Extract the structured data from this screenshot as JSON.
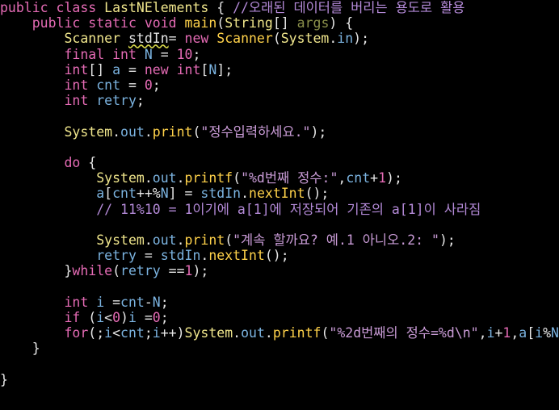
{
  "theme": {
    "background": "#000000",
    "keyword": "#e56bb5",
    "class_name": "#f0e68c",
    "identifier": "#7bb3e0",
    "function": "#ffd24a",
    "number": "#e56bb5",
    "string": "#c99bd6",
    "comment": "#b48ad8",
    "punctuation": "#e6e6e6"
  },
  "code": [
    [
      [
        "kw",
        "public"
      ],
      [
        "pl",
        " "
      ],
      [
        "kw",
        "class"
      ],
      [
        "pl",
        " "
      ],
      [
        "cls",
        "LastNElements"
      ],
      [
        "pl",
        " "
      ],
      [
        "pu",
        "{"
      ],
      [
        "pl",
        " "
      ],
      [
        "cm",
        "//오래된 데이터를 버리는 용도로 활용"
      ]
    ],
    [
      [
        "pl",
        "    "
      ],
      [
        "kw",
        "public"
      ],
      [
        "pl",
        " "
      ],
      [
        "kw",
        "static"
      ],
      [
        "pl",
        " "
      ],
      [
        "kw",
        "void"
      ],
      [
        "pl",
        " "
      ],
      [
        "fn",
        "main"
      ],
      [
        "pu",
        "("
      ],
      [
        "cls",
        "String"
      ],
      [
        "pu",
        "[]"
      ],
      [
        "pl",
        " "
      ],
      [
        "arg",
        "args"
      ],
      [
        "pu",
        ")"
      ],
      [
        "pl",
        " "
      ],
      [
        "pu",
        "{"
      ]
    ],
    [
      [
        "pl",
        "        "
      ],
      [
        "cls",
        "Scanner"
      ],
      [
        "pl",
        " "
      ],
      [
        "warn",
        "stdIn"
      ],
      [
        "pu",
        "="
      ],
      [
        "pl",
        " "
      ],
      [
        "kw",
        "new"
      ],
      [
        "pl",
        " "
      ],
      [
        "fn",
        "Scanner"
      ],
      [
        "pu",
        "("
      ],
      [
        "cls",
        "System"
      ],
      [
        "pu",
        "."
      ],
      [
        "id",
        "in"
      ],
      [
        "pu",
        ");"
      ]
    ],
    [
      [
        "pl",
        "        "
      ],
      [
        "kw",
        "final"
      ],
      [
        "pl",
        " "
      ],
      [
        "kw",
        "int"
      ],
      [
        "pl",
        " "
      ],
      [
        "id",
        "N"
      ],
      [
        "pl",
        " "
      ],
      [
        "pu",
        "="
      ],
      [
        "pl",
        " "
      ],
      [
        "num",
        "10"
      ],
      [
        "pu",
        ";"
      ]
    ],
    [
      [
        "pl",
        "        "
      ],
      [
        "kw",
        "int"
      ],
      [
        "pu",
        "[]"
      ],
      [
        "pl",
        " "
      ],
      [
        "id",
        "a"
      ],
      [
        "pl",
        " "
      ],
      [
        "pu",
        "="
      ],
      [
        "pl",
        " "
      ],
      [
        "kw",
        "new"
      ],
      [
        "pl",
        " "
      ],
      [
        "kw",
        "int"
      ],
      [
        "pu",
        "["
      ],
      [
        "id",
        "N"
      ],
      [
        "pu",
        "];"
      ]
    ],
    [
      [
        "pl",
        "        "
      ],
      [
        "kw",
        "int"
      ],
      [
        "pl",
        " "
      ],
      [
        "id",
        "cnt"
      ],
      [
        "pl",
        " "
      ],
      [
        "pu",
        "="
      ],
      [
        "pl",
        " "
      ],
      [
        "num",
        "0"
      ],
      [
        "pu",
        ";"
      ]
    ],
    [
      [
        "pl",
        "        "
      ],
      [
        "kw",
        "int"
      ],
      [
        "pl",
        " "
      ],
      [
        "id",
        "retry"
      ],
      [
        "pu",
        ";"
      ]
    ],
    [],
    [
      [
        "pl",
        "        "
      ],
      [
        "cls",
        "System"
      ],
      [
        "pu",
        "."
      ],
      [
        "id",
        "out"
      ],
      [
        "pu",
        "."
      ],
      [
        "fn",
        "print"
      ],
      [
        "pu",
        "("
      ],
      [
        "str",
        "\"정수입력하세요.\""
      ],
      [
        "pu",
        ");"
      ]
    ],
    [],
    [
      [
        "pl",
        "        "
      ],
      [
        "kw",
        "do"
      ],
      [
        "pl",
        " "
      ],
      [
        "pu",
        "{"
      ]
    ],
    [
      [
        "pl",
        "            "
      ],
      [
        "cls",
        "System"
      ],
      [
        "pu",
        "."
      ],
      [
        "id",
        "out"
      ],
      [
        "pu",
        "."
      ],
      [
        "fn",
        "printf"
      ],
      [
        "pu",
        "("
      ],
      [
        "str",
        "\"%d번째 정수:\""
      ],
      [
        "pu",
        ","
      ],
      [
        "id",
        "cnt"
      ],
      [
        "pu",
        "+"
      ],
      [
        "num",
        "1"
      ],
      [
        "pu",
        ");"
      ]
    ],
    [
      [
        "pl",
        "            "
      ],
      [
        "id",
        "a"
      ],
      [
        "pu",
        "["
      ],
      [
        "id",
        "cnt"
      ],
      [
        "pu",
        "++%"
      ],
      [
        "id",
        "N"
      ],
      [
        "pu",
        "]"
      ],
      [
        "pl",
        " "
      ],
      [
        "pu",
        "="
      ],
      [
        "pl",
        " "
      ],
      [
        "id",
        "stdIn"
      ],
      [
        "pu",
        "."
      ],
      [
        "fn",
        "nextInt"
      ],
      [
        "pu",
        "();"
      ]
    ],
    [
      [
        "pl",
        "            "
      ],
      [
        "cm",
        "// 11%10 = 1이기에 a[1]에 저장되어 기존의 a[1]이 사라짐"
      ]
    ],
    [],
    [
      [
        "pl",
        "            "
      ],
      [
        "cls",
        "System"
      ],
      [
        "pu",
        "."
      ],
      [
        "id",
        "out"
      ],
      [
        "pu",
        "."
      ],
      [
        "fn",
        "print"
      ],
      [
        "pu",
        "("
      ],
      [
        "str",
        "\"계속 할까요? 예.1 아니오.2: \""
      ],
      [
        "pu",
        ");"
      ]
    ],
    [
      [
        "pl",
        "            "
      ],
      [
        "id",
        "retry"
      ],
      [
        "pl",
        " "
      ],
      [
        "pu",
        "="
      ],
      [
        "pl",
        " "
      ],
      [
        "id",
        "stdIn"
      ],
      [
        "pu",
        "."
      ],
      [
        "fn",
        "nextInt"
      ],
      [
        "pu",
        "();"
      ]
    ],
    [
      [
        "pl",
        "        "
      ],
      [
        "pu",
        "}"
      ],
      [
        "kw",
        "while"
      ],
      [
        "pu",
        "("
      ],
      [
        "id",
        "retry"
      ],
      [
        "pl",
        " "
      ],
      [
        "pu",
        "=="
      ],
      [
        "num",
        "1"
      ],
      [
        "pu",
        ");"
      ]
    ],
    [],
    [
      [
        "pl",
        "        "
      ],
      [
        "kw",
        "int"
      ],
      [
        "pl",
        " "
      ],
      [
        "id",
        "i"
      ],
      [
        "pl",
        " "
      ],
      [
        "pu",
        "="
      ],
      [
        "id",
        "cnt"
      ],
      [
        "pu",
        "-"
      ],
      [
        "id",
        "N"
      ],
      [
        "pu",
        ";"
      ]
    ],
    [
      [
        "pl",
        "        "
      ],
      [
        "kw",
        "if"
      ],
      [
        "pl",
        " "
      ],
      [
        "pu",
        "("
      ],
      [
        "id",
        "i"
      ],
      [
        "pu",
        "<"
      ],
      [
        "num",
        "0"
      ],
      [
        "pu",
        ")"
      ],
      [
        "id",
        "i"
      ],
      [
        "pl",
        " "
      ],
      [
        "pu",
        "="
      ],
      [
        "num",
        "0"
      ],
      [
        "pu",
        ";"
      ]
    ],
    [
      [
        "pl",
        "        "
      ],
      [
        "kw",
        "for"
      ],
      [
        "pu",
        "(;"
      ],
      [
        "id",
        "i"
      ],
      [
        "pu",
        "<"
      ],
      [
        "id",
        "cnt"
      ],
      [
        "pu",
        ";"
      ],
      [
        "id",
        "i"
      ],
      [
        "pu",
        "++)"
      ],
      [
        "cls",
        "System"
      ],
      [
        "pu",
        "."
      ],
      [
        "id",
        "out"
      ],
      [
        "pu",
        "."
      ],
      [
        "fn",
        "printf"
      ],
      [
        "pu",
        "("
      ],
      [
        "str",
        "\"%2d번째의 정수=%d\\n\""
      ],
      [
        "pu",
        ","
      ],
      [
        "id",
        "i"
      ],
      [
        "pu",
        "+"
      ],
      [
        "num",
        "1"
      ],
      [
        "pu",
        ","
      ],
      [
        "id",
        "a"
      ],
      [
        "pu",
        "["
      ],
      [
        "id",
        "i"
      ],
      [
        "pu",
        "%"
      ],
      [
        "id",
        "N"
      ],
      [
        "pu",
        "]);"
      ]
    ],
    [
      [
        "pl",
        "    "
      ],
      [
        "pu",
        "}"
      ]
    ],
    [],
    [
      [
        "pu",
        "}"
      ]
    ]
  ]
}
